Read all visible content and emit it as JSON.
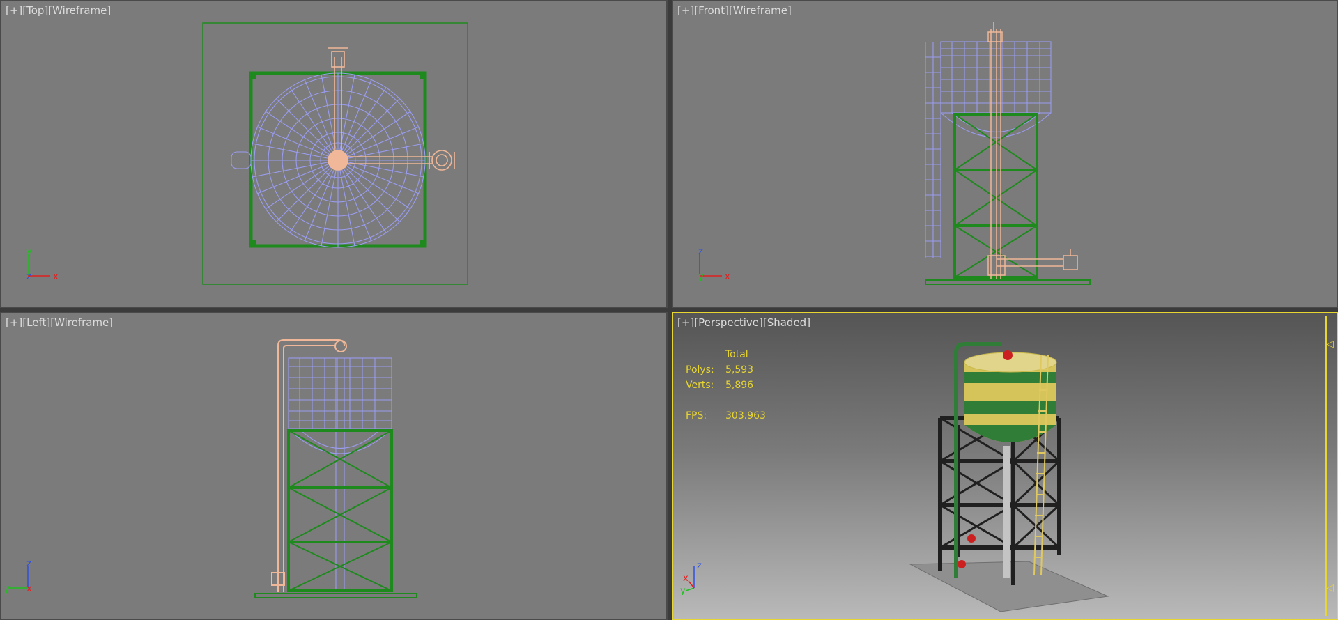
{
  "viewports": {
    "top": {
      "plus": "[+]",
      "view": "[Top]",
      "mode": "[Wireframe]",
      "axis_v": "y",
      "axis_z": "z",
      "axis_h": "x"
    },
    "front": {
      "plus": "[+]",
      "view": "[Front]",
      "mode": "[Wireframe]",
      "axis_v": "z",
      "axis_z": "y",
      "axis_h": "x"
    },
    "left": {
      "plus": "[+]",
      "view": "[Left]",
      "mode": "[Wireframe]",
      "axis_v": "z",
      "axis_z": "y",
      "axis_h": "x"
    },
    "perspective": {
      "plus": "[+]",
      "view": "[Perspective]",
      "mode": "[Shaded]",
      "axis_v": "z",
      "axis_z": "y",
      "axis_h": "x",
      "stats": {
        "header": "Total",
        "polys_label": "Polys:",
        "polys_value": "5,593",
        "verts_label": "Verts:",
        "verts_value": "5,896",
        "fps_label": "FPS:",
        "fps_value": "303.963"
      }
    }
  },
  "colors": {
    "viewport_bg": "#7b7b7b",
    "active_border": "#e8d630",
    "frame_green": "#1e8a1e",
    "tank_wire": "#9a9cf0",
    "pipe_wire": "#f0b898",
    "stats_text": "#e8d630",
    "axis_x": "#e02020",
    "axis_y": "#20c020",
    "axis_z": "#3050e0"
  }
}
